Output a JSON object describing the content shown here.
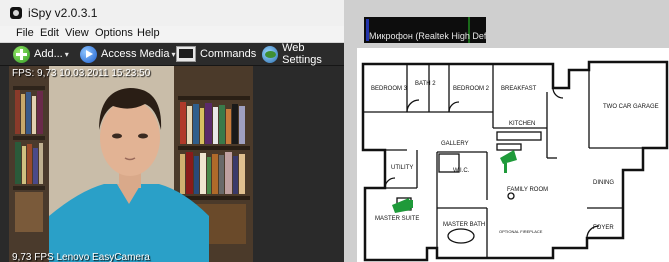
{
  "window": {
    "title": "iSpy v2.0.3.1"
  },
  "menu": [
    "File",
    "Edit",
    "View",
    "Options",
    "Help"
  ],
  "toolbar": {
    "add": "Add...",
    "access_media": "Access Media",
    "commands": "Commands",
    "web_settings": "Web Settings"
  },
  "camera": {
    "overlay_top": "FPS: 9,73 10.03.2011 15:23:50",
    "overlay_bottom": "9,73 FPS  Lenovo EasyCamera"
  },
  "audio": {
    "label": "Микрофон (Realtek High Defini"
  },
  "floorplan": {
    "rooms": {
      "bedroom3": "BEDROOM 3",
      "bath2": "BATH 2",
      "bedroom2": "BEDROOM 2",
      "breakfast": "BREAKFAST",
      "garage": "TWO CAR GARAGE",
      "kitchen": "KITCHEN",
      "gallery": "GALLERY",
      "utility": "UTILITY",
      "wic": "W.I.C.",
      "family": "FAMILY ROOM",
      "dining": "DINING",
      "master_suite": "MASTER SUITE",
      "master_bath": "MASTER BATH",
      "foyer": "FOYER",
      "fireplace": "OPTIONAL FIREPLACE"
    }
  },
  "colors": {
    "camera_marker": "#1f9a3a",
    "toolbar_bg": "#2b2b2b"
  }
}
